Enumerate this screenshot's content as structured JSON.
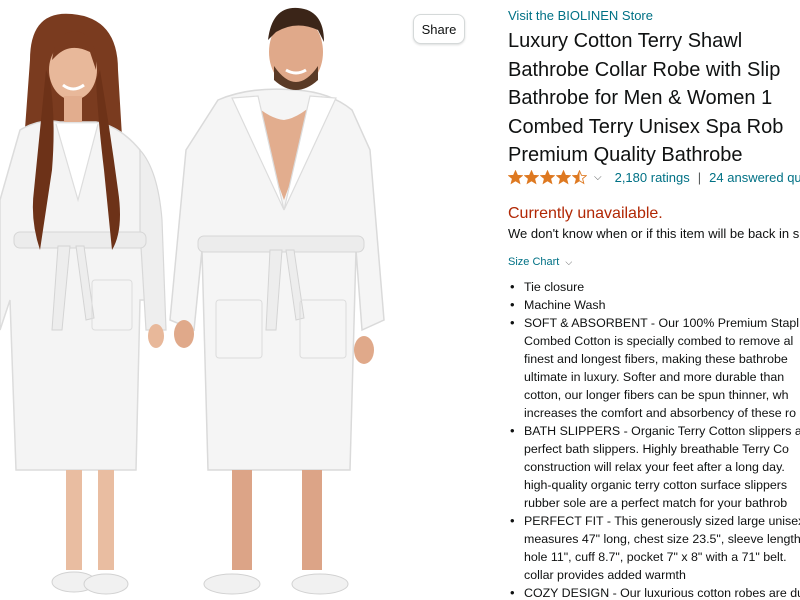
{
  "image_panel": {
    "share_label": "Share"
  },
  "product": {
    "store_link": "Visit the BIOLINEN Store",
    "title_lines": [
      "Luxury Cotton Terry Shawl",
      "Bathrobe Collar Robe with Slip",
      "Bathrobe for Men & Women 1",
      "Combed Terry Unisex Spa Rob",
      "Premium Quality Bathrobe"
    ],
    "rating_value": 4.5,
    "ratings_count": "2,180 ratings",
    "separator": "|",
    "answered": "24 answered que",
    "availability": "Currently unavailable.",
    "availability_note": "We don't know when or if this item will be back in s",
    "size_chart": "Size Chart"
  },
  "bullets": [
    {
      "lines": [
        "Tie closure"
      ]
    },
    {
      "lines": [
        "Machine Wash"
      ]
    },
    {
      "lines": [
        "SOFT & ABSORBENT - Our 100% Premium Stapl",
        "Combed Cotton is specially combed to remove al",
        "finest and longest fibers, making these bathrobe",
        "ultimate in luxury. Softer and more durable than",
        "cotton, our longer fibers can be spun thinner, wh",
        "increases the comfort and absorbency of these ro"
      ]
    },
    {
      "lines": [
        "BATH SLIPPERS - Organic Terry Cotton slippers a",
        "perfect bath slippers. Highly breathable Terry Co",
        "construction will relax your feet after a long day.",
        "high-quality organic terry cotton surface slippers",
        "rubber sole are a perfect match for your bathrob"
      ]
    },
    {
      "lines": [
        "PERFECT FIT - This generously sized large unisex",
        "measures 47\" long, chest size 23.5\", sleeve length",
        "hole 11\", cuff 8.7\", pocket 7\" x 8\" with a 71\" belt.",
        "collar provides added warmth"
      ]
    },
    {
      "lines": [
        "COZY DESIGN - Our luxurious cotton robes are du"
      ]
    }
  ],
  "colors": {
    "link": "#007185",
    "unavailable": "#b12704",
    "star": "#de7921",
    "text": "#0f1111"
  },
  "icons": {
    "star": "star-icon",
    "chevron": "chevron-down-icon"
  }
}
